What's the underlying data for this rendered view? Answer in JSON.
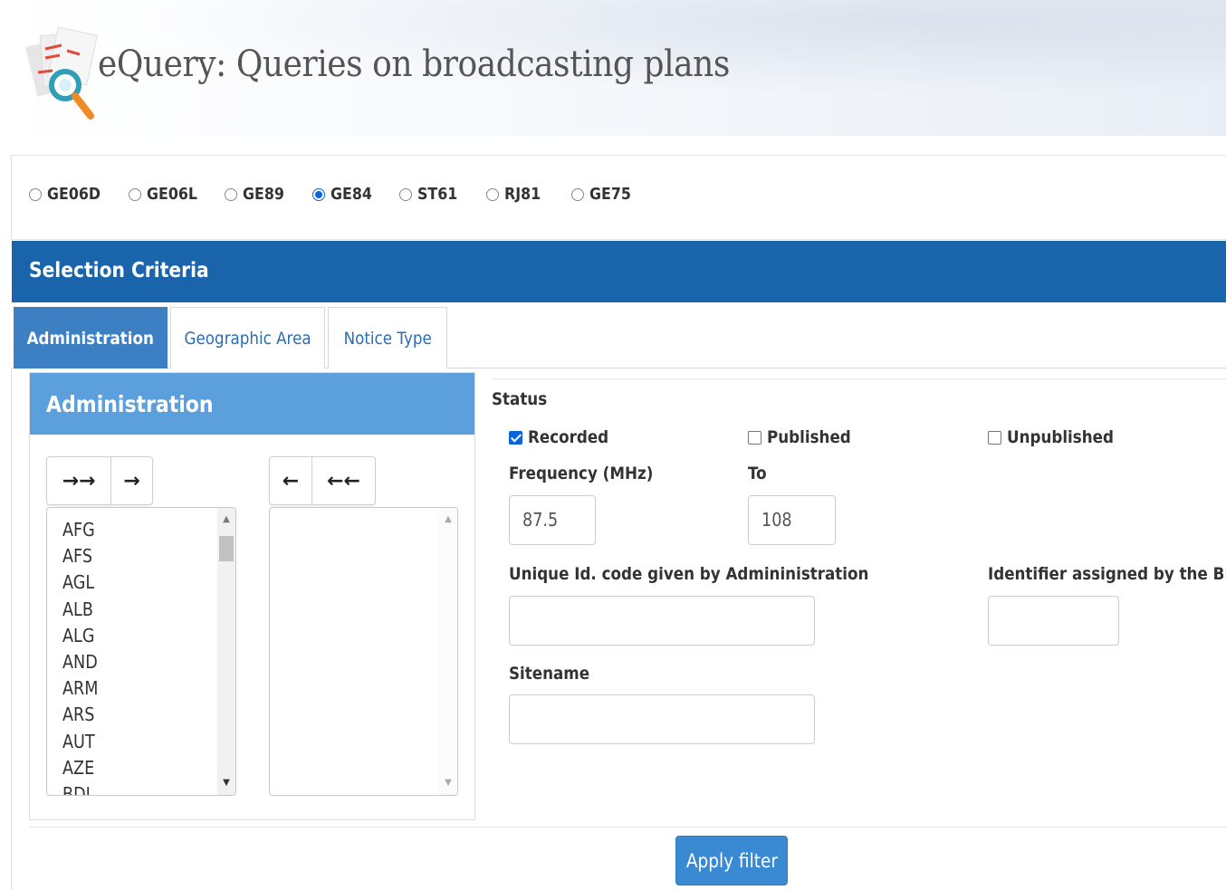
{
  "header": {
    "title": "eQuery: Queries on broadcasting plans",
    "logo_icon": "document-magnifier-logo"
  },
  "plans": {
    "items": [
      {
        "label": "GE06D",
        "checked": false
      },
      {
        "label": "GE06L",
        "checked": false
      },
      {
        "label": "GE89",
        "checked": false
      },
      {
        "label": "GE84",
        "checked": true
      },
      {
        "label": "ST61",
        "checked": false
      },
      {
        "label": "RJ81",
        "checked": false
      },
      {
        "label": "GE75",
        "checked": false
      }
    ]
  },
  "criteria": {
    "title": "Selection Criteria",
    "color": "#1a64ab"
  },
  "tabs": [
    {
      "label": "Administration",
      "active": true
    },
    {
      "label": "Geographic Area",
      "active": false
    },
    {
      "label": "Notice Type",
      "active": false
    }
  ],
  "admin_panel": {
    "title": "Administration",
    "buttons_left": [
      "→→",
      "→"
    ],
    "buttons_right": [
      "←",
      "←←"
    ],
    "available": [
      "AFG",
      "AFS",
      "AGL",
      "ALB",
      "ALG",
      "AND",
      "ARM",
      "ARS",
      "AUT",
      "AZE",
      "BDI"
    ],
    "selected": []
  },
  "form": {
    "status_label": "Status",
    "status_options": [
      {
        "label": "Recorded",
        "checked": true
      },
      {
        "label": "Published",
        "checked": false
      },
      {
        "label": "Unpublished",
        "checked": false
      }
    ],
    "frequency_label": "Frequency (MHz)",
    "to_label": "To",
    "freq_from": "87.5",
    "freq_to": "108",
    "unique_id_label": "Unique Id. code given by Admininistration",
    "unique_id_value": "",
    "br_id_label": "Identifier assigned by the BR",
    "br_id_value": "",
    "sitename_label": "Sitename",
    "sitename_value": ""
  },
  "actions": {
    "apply_label": "Apply filter"
  }
}
